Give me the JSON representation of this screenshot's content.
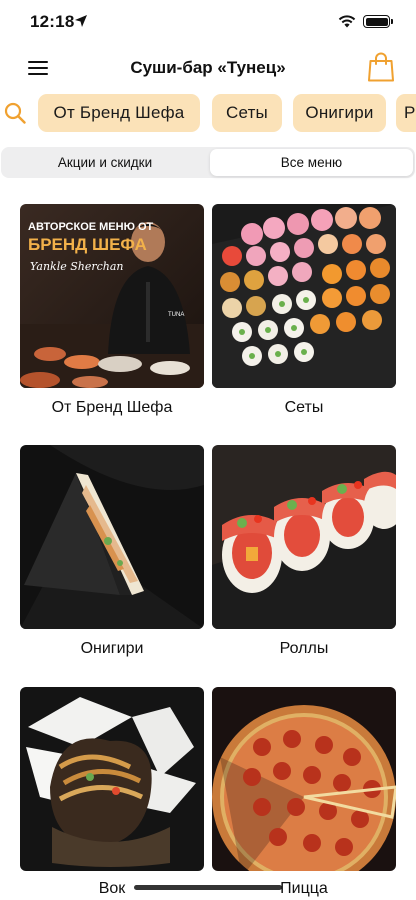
{
  "status": {
    "time": "12:18"
  },
  "header": {
    "title": "Суши-бар «Тунец»"
  },
  "categories": [
    {
      "label": "От Бренд Шефа"
    },
    {
      "label": "Сеты"
    },
    {
      "label": "Онигири"
    },
    {
      "label": "Р"
    }
  ],
  "segments": {
    "left": "Акции и скидки",
    "right": "Все меню",
    "selected": "right"
  },
  "menu": [
    {
      "label": "От Бренд Шефа",
      "image": "brand-chef-photo"
    },
    {
      "label": "Сеты",
      "image": "sushi-sets-photo"
    },
    {
      "label": "Онигири",
      "image": "onigiri-photo"
    },
    {
      "label": "Роллы",
      "image": "rolls-photo"
    },
    {
      "label": "Вок",
      "image": "wok-box-photo"
    },
    {
      "label": "Пицца",
      "image": "pizza-photo"
    }
  ],
  "promo": {
    "line1": "АВТОРСКОЕ МЕНЮ ОТ",
    "line2": "БРЕНД ШЕФА",
    "signature": "Yankle Sherchan",
    "brand": "TUNA"
  },
  "colors": {
    "accent": "#f0a130",
    "chip_bg": "#fbe2b8",
    "segment_bg": "#eeeeef"
  },
  "icons": [
    "location-arrow-icon",
    "wifi-icon",
    "battery-icon",
    "hamburger-menu-icon",
    "shopping-bag-icon",
    "search-icon"
  ]
}
